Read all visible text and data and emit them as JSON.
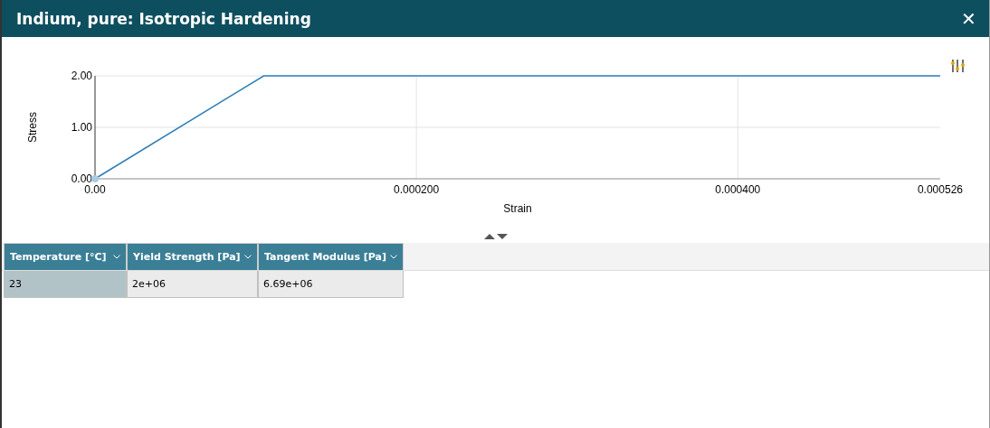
{
  "window": {
    "title": "Indium, pure: Isotropic Hardening",
    "close_label": "✕"
  },
  "chart": {
    "chart_data": {
      "type": "line",
      "grid": true,
      "xlabel": "Strain",
      "ylabel": "Stress",
      "xlim": [
        0,
        0.000526
      ],
      "ylim": [
        0,
        2
      ],
      "xticks": [
        {
          "value": 0,
          "label": "0.00"
        },
        {
          "value": 0.0002,
          "label": "0.000200"
        },
        {
          "value": 0.0004,
          "label": "0.000400"
        },
        {
          "value": 0.000526,
          "label": "0.000526"
        }
      ],
      "yticks": [
        {
          "value": 0,
          "label": "0.00"
        },
        {
          "value": 1,
          "label": "1.00"
        },
        {
          "value": 2,
          "label": "2.00"
        }
      ],
      "x": [
        0,
        0.000105,
        0.000526
      ],
      "series": [
        {
          "color": "#2e7fb8",
          "values": [
            0,
            2,
            2
          ]
        }
      ]
    }
  },
  "table": {
    "columns": [
      "Temperature [°C]",
      "Yield Strength [Pa]",
      "Tangent Modulus [Pa]"
    ],
    "rows": [
      {
        "cells": [
          {
            "text": "23",
            "selected": true
          },
          {
            "text": "2e+06",
            "selected": false
          },
          {
            "text": "6.69e+06",
            "selected": false
          }
        ]
      }
    ]
  }
}
